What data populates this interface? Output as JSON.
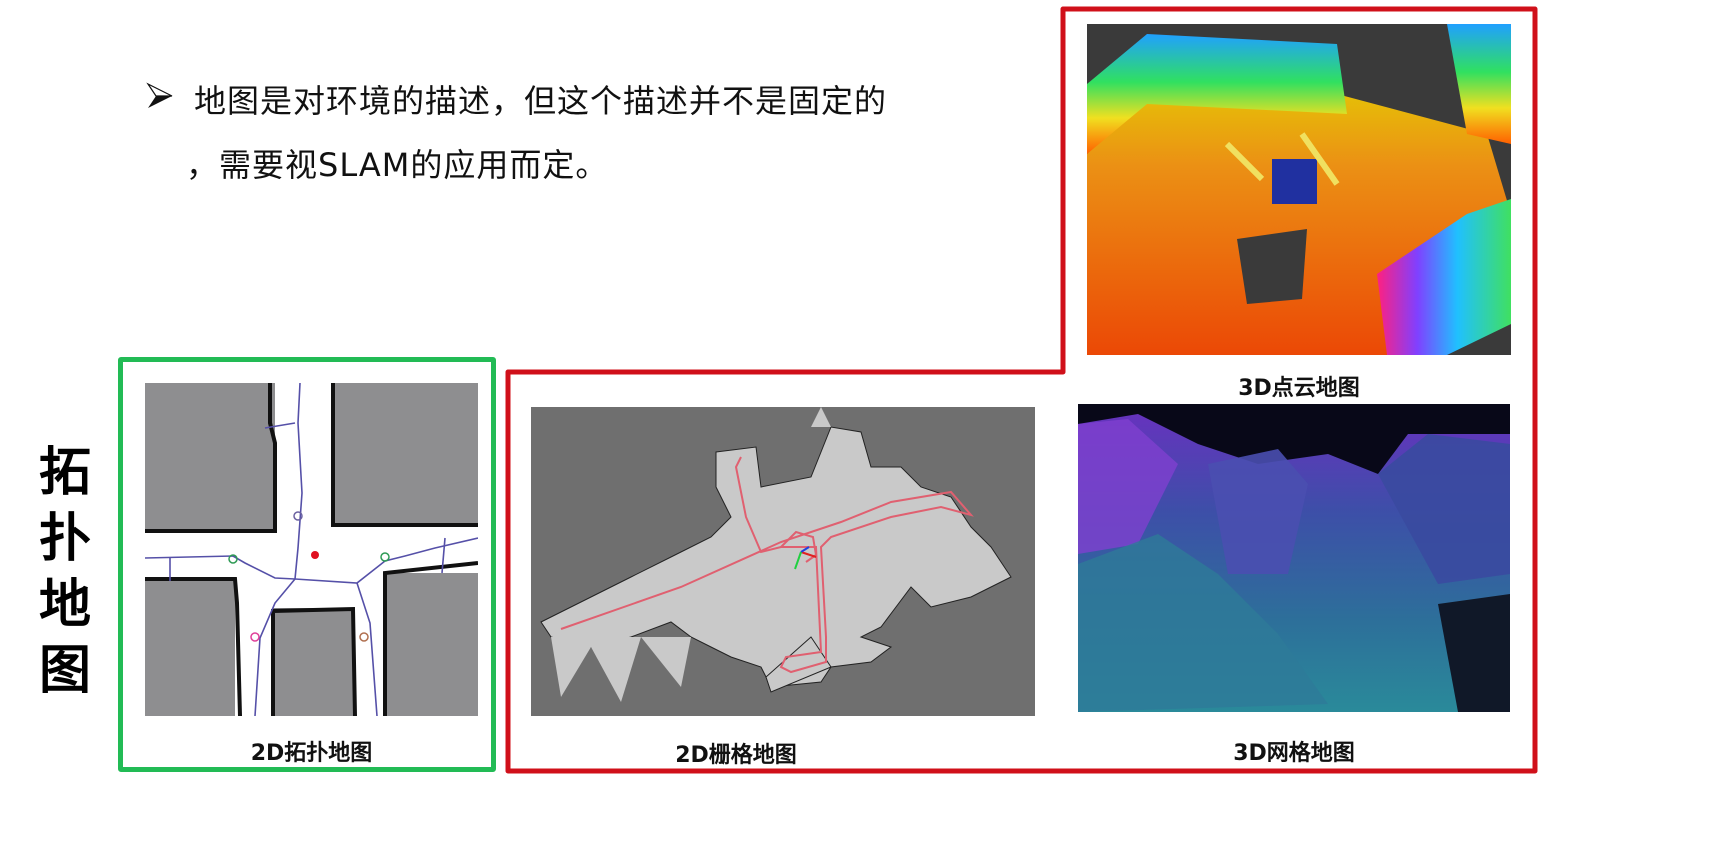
{
  "slide": {
    "bullet_icon": "arrowhead-bullet-icon",
    "bullet_line1": "地图是对环境的描述，但这个描述并不是固定的",
    "bullet_line2": "，需要视SLAM的应用而定。",
    "side_title": [
      "拓",
      "扑",
      "地",
      "图"
    ]
  },
  "figures": {
    "topological": {
      "caption": "2D拓扑地图",
      "frame_color": "#22bb55"
    },
    "grid": {
      "caption": "2D栅格地图"
    },
    "point_cloud": {
      "caption": "3D点云地图"
    },
    "mesh": {
      "caption": "3D网格地图"
    },
    "group_frame_color": "#d0101a"
  }
}
